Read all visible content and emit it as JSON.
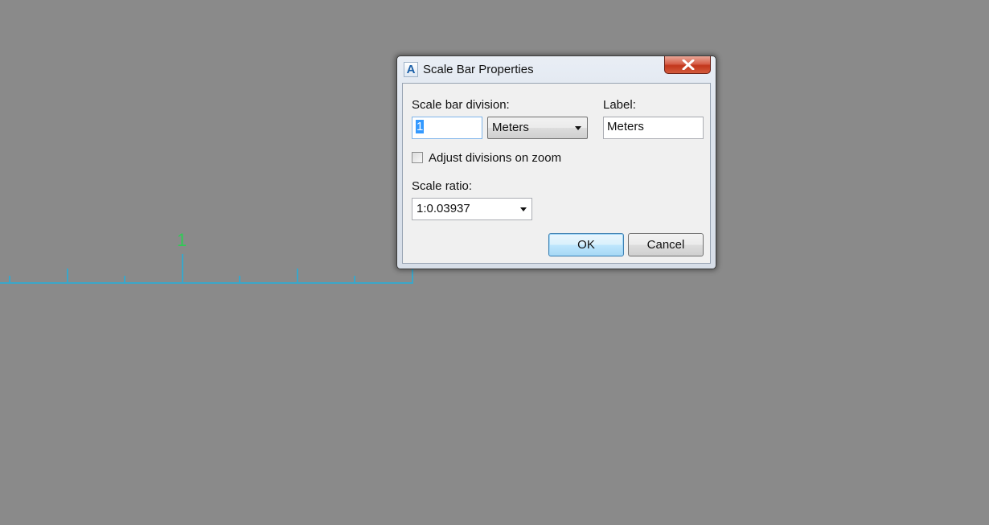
{
  "dialog": {
    "title": "Scale Bar Properties",
    "app_icon_glyph": "A",
    "close_icon": "close-icon",
    "division_label": "Scale bar division:",
    "division_value": "1",
    "units_selected": "Meters",
    "label_caption": "Label:",
    "label_value": "Meters",
    "adjust_label": "Adjust divisions on zoom",
    "adjust_checked": false,
    "ratio_label": "Scale ratio:",
    "ratio_value": "1:0.03937",
    "ok_label": "OK",
    "cancel_label": "Cancel"
  },
  "canvas": {
    "scale_bar_number": "1",
    "bar_color": "#3aa6c9",
    "label_color": "#2ecc55",
    "background_color": "#8a8a8a"
  }
}
